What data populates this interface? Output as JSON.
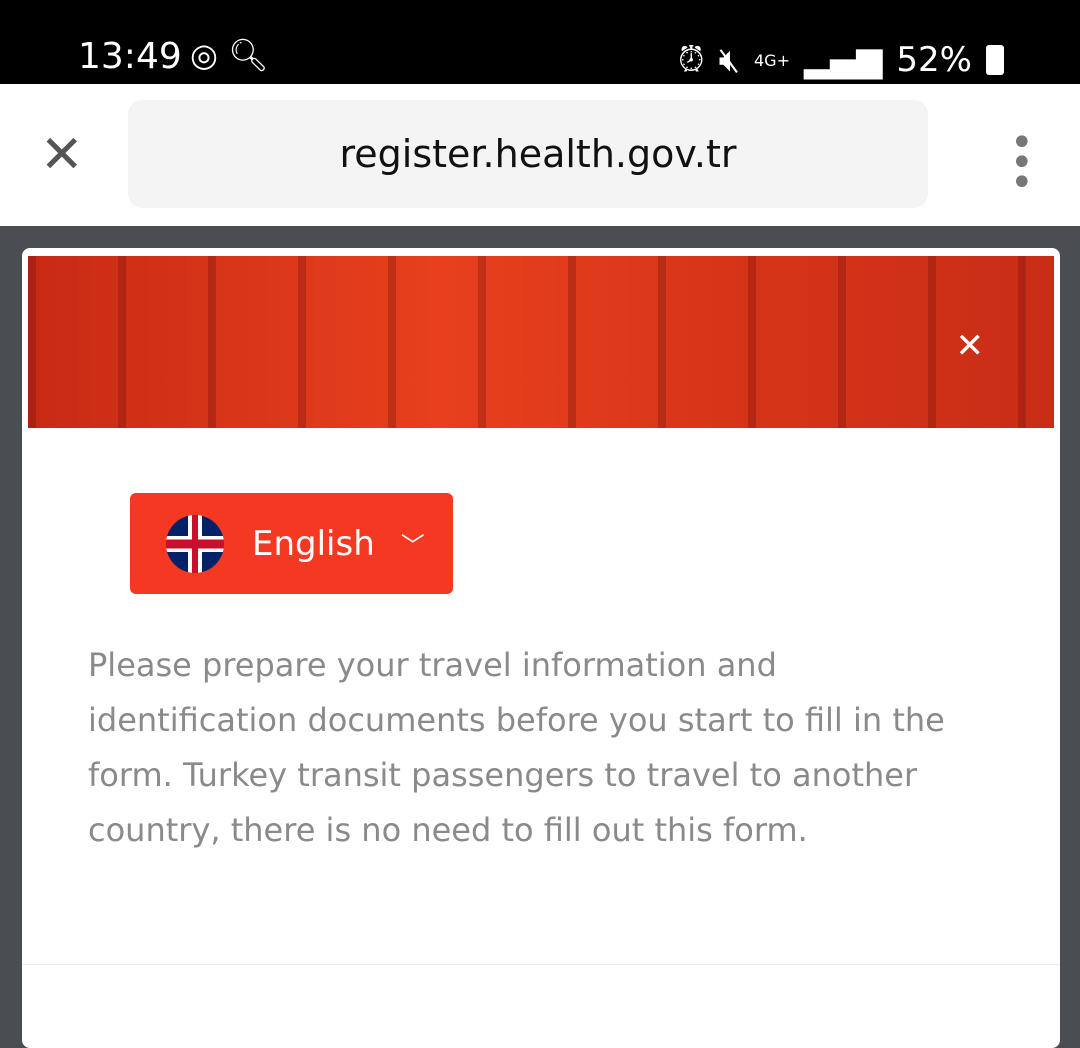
{
  "status": {
    "time": "13:49",
    "battery": "52%",
    "network": "4G+"
  },
  "browser": {
    "url": "register.health.gov.tr"
  },
  "card": {
    "language": "English",
    "message": "Please prepare your travel information and identification documents before you start to fill in the form. Turkey transit passengers to travel to another country, there is no need to fill out this form."
  },
  "colors": {
    "accent": "#f53822"
  }
}
